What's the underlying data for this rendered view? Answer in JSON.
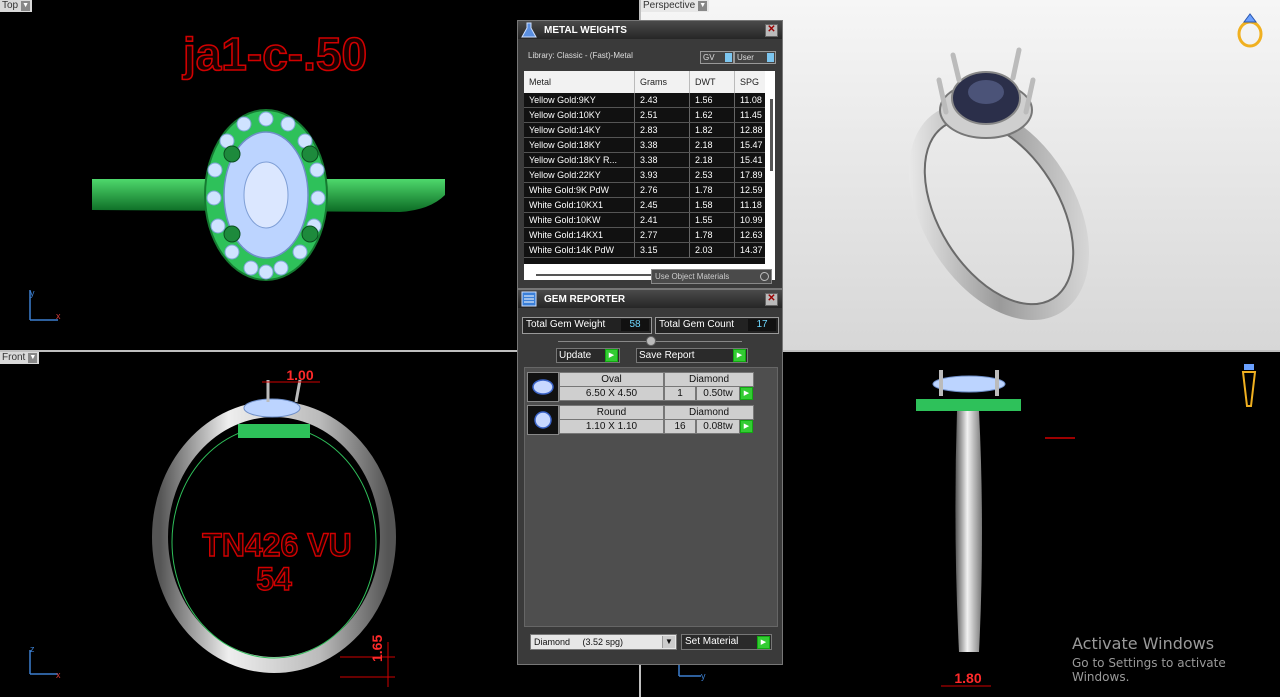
{
  "viewports": {
    "top": {
      "label": "Top",
      "text": "ja1-c-.50"
    },
    "perspective": {
      "label": "Perspective"
    },
    "front": {
      "label": "Front",
      "text_line1": "TN426 VU",
      "text_line2": "54",
      "dim_top": "1.00",
      "dim_side": "1.65"
    },
    "right": {
      "dim_bottom": "1.80"
    }
  },
  "metal_weights": {
    "title": "METAL WEIGHTS",
    "library": "Library: Classic - (Fast)-Metal",
    "toggle_gv": "GV",
    "toggle_user": "User",
    "columns": [
      "Metal",
      "Grams",
      "DWT",
      "SPG"
    ],
    "rows": [
      [
        "Yellow Gold:9KY",
        "2.43",
        "1.56",
        "11.08"
      ],
      [
        "Yellow Gold:10KY",
        "2.51",
        "1.62",
        "11.45"
      ],
      [
        "Yellow Gold:14KY",
        "2.83",
        "1.82",
        "12.88"
      ],
      [
        "Yellow Gold:18KY",
        "3.38",
        "2.18",
        "15.47"
      ],
      [
        "Yellow Gold:18KY R...",
        "3.38",
        "2.18",
        "15.41"
      ],
      [
        "Yellow Gold:22KY",
        "3.93",
        "2.53",
        "17.89"
      ],
      [
        "White Gold:9K PdW",
        "2.76",
        "1.78",
        "12.59"
      ],
      [
        "White Gold:10KX1",
        "2.45",
        "1.58",
        "11.18"
      ],
      [
        "White Gold:10KW",
        "2.41",
        "1.55",
        "10.99"
      ],
      [
        "White Gold:14KX1",
        "2.77",
        "1.78",
        "12.63"
      ],
      [
        "White Gold:14K PdW",
        "3.15",
        "2.03",
        "14.37"
      ]
    ],
    "use_object_materials": "Use Object Materials"
  },
  "gem_reporter": {
    "title": "GEM REPORTER",
    "total_weight_label": "Total Gem Weight",
    "total_weight_value": "58",
    "total_count_label": "Total Gem Count",
    "total_count_value": "17",
    "update_label": "Update",
    "save_report_label": "Save Report",
    "gems": [
      {
        "shape": "Oval",
        "material": "Diamond",
        "size": "6.50 X 4.50",
        "count": "1",
        "weight": "0.50tw"
      },
      {
        "shape": "Round",
        "material": "Diamond",
        "size": "1.10 X 1.10",
        "count": "16",
        "weight": "0.08tw"
      }
    ],
    "material_select": "Diamond     (3.52 spg)",
    "set_material_label": "Set Material"
  },
  "watermark": {
    "line1": "Activate Windows",
    "line2": "Go to Settings to activate Windows."
  }
}
